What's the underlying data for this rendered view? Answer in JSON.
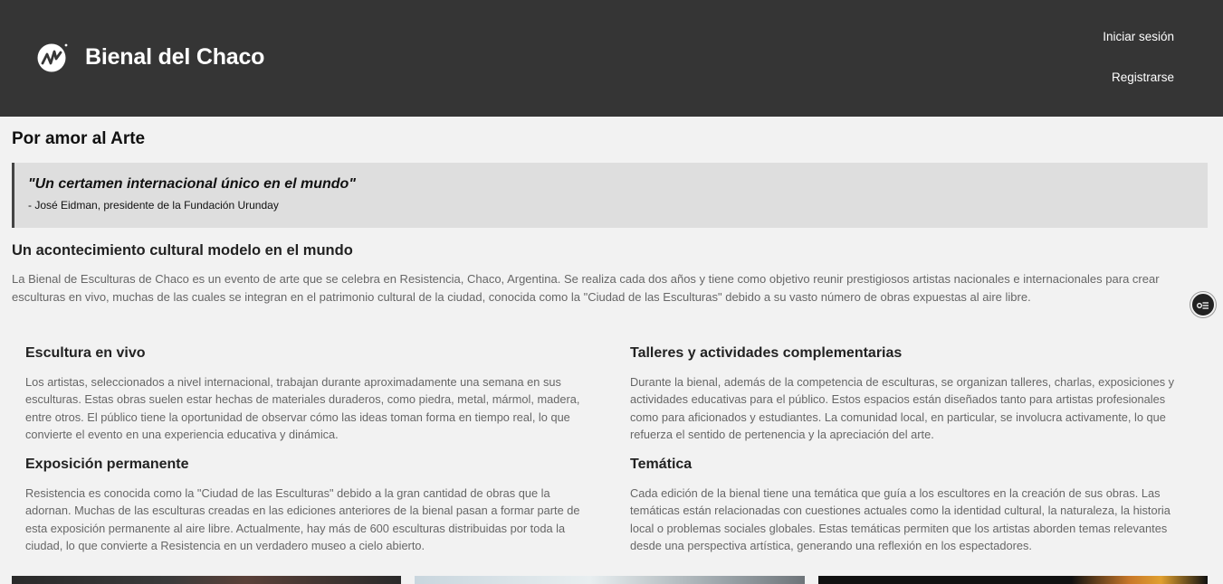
{
  "header": {
    "brand": "Bienal del Chaco",
    "login_label": "Iniciar sesión",
    "register_label": "Registrarse"
  },
  "main": {
    "title": "Por amor al Arte",
    "quote": {
      "text": "\"Un certamen internacional único en el mundo\"",
      "author": "- José Eidman, presidente de la Fundación Urunday"
    },
    "intro": {
      "heading": "Un acontecimiento cultural modelo en el mundo",
      "text": "La Bienal de Esculturas de Chaco es un evento de arte que se celebra en Resistencia, Chaco, Argentina. Se realiza cada dos años y tiene como objetivo reunir prestigiosos artistas nacionales e internacionales para crear esculturas en vivo, muchas de las cuales se integran en el patrimonio cultural de la ciudad, conocida como la \"Ciudad de las Esculturas\" debido a su vasto número de obras expuestas al aire libre."
    },
    "sections": [
      {
        "heading": "Escultura en vivo",
        "text": "Los artistas, seleccionados a nivel internacional, trabajan durante aproximadamente una semana en sus esculturas. Estas obras suelen estar hechas de materiales duraderos, como piedra, metal, mármol, madera, entre otros. El público tiene la oportunidad de observar cómo las ideas toman forma en tiempo real, lo que convierte el evento en una experiencia educativa y dinámica."
      },
      {
        "heading": "Talleres y actividades complementarias",
        "text": "Durante la bienal, además de la competencia de esculturas, se organizan talleres, charlas, exposiciones y actividades educativas para el público. Estos espacios están diseñados tanto para artistas profesionales como para aficionados y estudiantes. La comunidad local, en particular, se involucra activamente, lo que refuerza el sentido de pertenencia y la apreciación del arte."
      },
      {
        "heading": "Exposición permanente",
        "text": "Resistencia es conocida como la \"Ciudad de las Esculturas\" debido a la gran cantidad de obras que la adornan. Muchas de las esculturas creadas en las ediciones anteriores de la bienal pasan a formar parte de esta exposición permanente al aire libre. Actualmente, hay más de 600 esculturas distribuidas por toda la ciudad, lo que convierte a Resistencia en un verdadero museo a cielo abierto."
      },
      {
        "heading": "Temática",
        "text": "Cada edición de la bienal tiene una temática que guía a los escultores en la creación de sus obras. Las temáticas están relacionadas con cuestiones actuales como la identidad cultural, la naturaleza, la historia local o problemas sociales globales. Estas temáticas permiten que los artistas aborden temas relevantes desde una perspectiva artística, generando una reflexión en los espectadores."
      }
    ]
  },
  "icons": {
    "logo": "bienal-logo-icon",
    "floating": "list-menu-icon"
  }
}
